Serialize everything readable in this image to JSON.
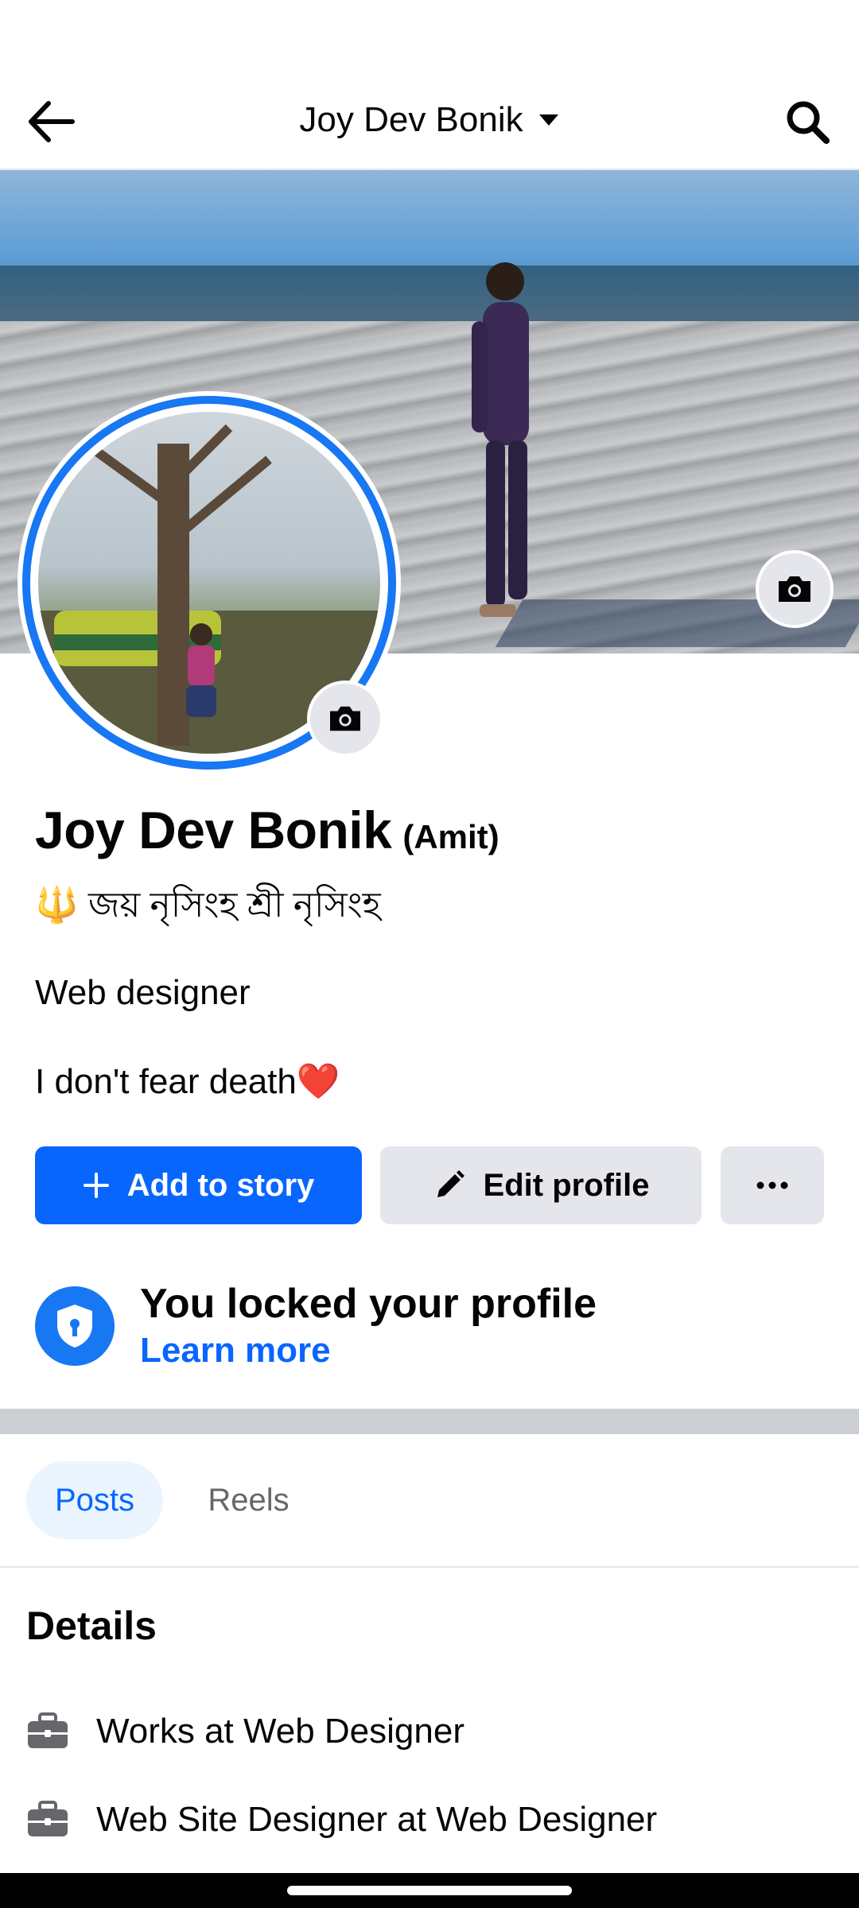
{
  "header": {
    "title": "Joy Dev Bonik",
    "back_icon": "arrow-left-icon",
    "dropdown_icon": "caret-down-icon",
    "search_icon": "search-icon"
  },
  "profile": {
    "name": "Joy Dev Bonik",
    "alternate_name": "(Amit)",
    "bio_line_1": "🔱 জয় নৃসিংহ শ্রী নৃসিংহ",
    "bio_line_2": "Web designer",
    "bio_line_3": "I don't fear death❤️"
  },
  "actions": {
    "add_story_label": "Add to story",
    "edit_profile_label": "Edit profile",
    "more_icon": "ellipsis-icon"
  },
  "lock_notice": {
    "title": "You locked your profile",
    "link": "Learn more"
  },
  "tabs": [
    {
      "label": "Posts",
      "active": true
    },
    {
      "label": "Reels",
      "active": false
    }
  ],
  "details": {
    "title": "Details",
    "items": [
      {
        "icon": "briefcase-icon",
        "text": "Works at Web Designer"
      },
      {
        "icon": "briefcase-icon",
        "text": "Web Site Designer at Web Designer"
      }
    ]
  },
  "colors": {
    "accent": "#0866ff",
    "ring": "#1877f2",
    "button_grey": "#e4e6eb",
    "divider": "#cbced3"
  }
}
